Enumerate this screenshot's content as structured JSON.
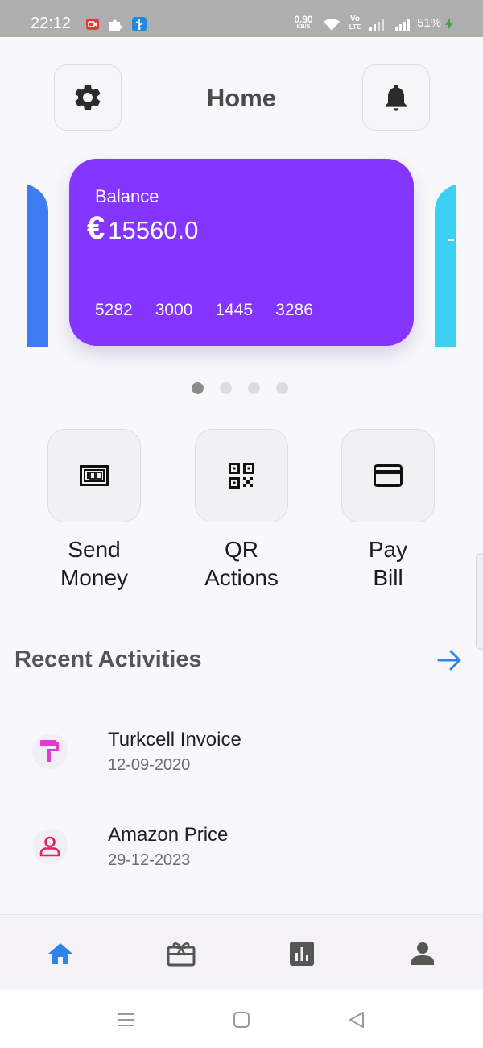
{
  "status_bar": {
    "time": "22:12",
    "net_speed_value": "0.90",
    "net_speed_unit": "KB/S",
    "volte_top": "Vo",
    "volte_bottom": "LTE",
    "battery": "51%",
    "icons": [
      "screen-record-icon",
      "puzzle-icon",
      "usb-icon",
      "wifi-icon",
      "volte-icon",
      "signal-icon",
      "signal-icon",
      "charging-icon"
    ]
  },
  "header": {
    "title": "Home",
    "left_icon": "gear-icon",
    "right_icon": "bell-icon"
  },
  "cards": {
    "main": {
      "label": "Balance",
      "currency": "€",
      "amount": "15560.0",
      "number_groups": [
        "5282",
        "3000",
        "1445",
        "3286"
      ],
      "color": "#8435ff"
    },
    "left_color": "#3d7cf2",
    "right_color": "#3bd0f4",
    "pages": 4,
    "active_page": 1
  },
  "actions": [
    {
      "line1": "Send",
      "line2": "Money",
      "icon": "money-icon"
    },
    {
      "line1": "QR",
      "line2": "Actions",
      "icon": "qr-code-icon"
    },
    {
      "line1": "Pay",
      "line2": "Bill",
      "icon": "credit-card-icon"
    }
  ],
  "recent": {
    "title": "Recent Activities",
    "arrow_icon": "arrow-right-icon",
    "items": [
      {
        "title": "Turkcell Invoice",
        "date": "12-09-2020",
        "icon": "paint-roller-icon",
        "icon_color": "#e23ccf"
      },
      {
        "title": "Amazon Price",
        "date": "29-12-2023",
        "icon": "person-icon",
        "icon_color": "#e0245e"
      }
    ]
  },
  "bottom_nav": {
    "items": [
      "home-icon",
      "gift-card-icon",
      "bar-chart-icon",
      "person-icon"
    ],
    "active_color": "#2f86e6",
    "inactive_color": "#555555"
  },
  "system_nav": [
    "menu-icon",
    "home-square-icon",
    "back-triangle-icon"
  ]
}
